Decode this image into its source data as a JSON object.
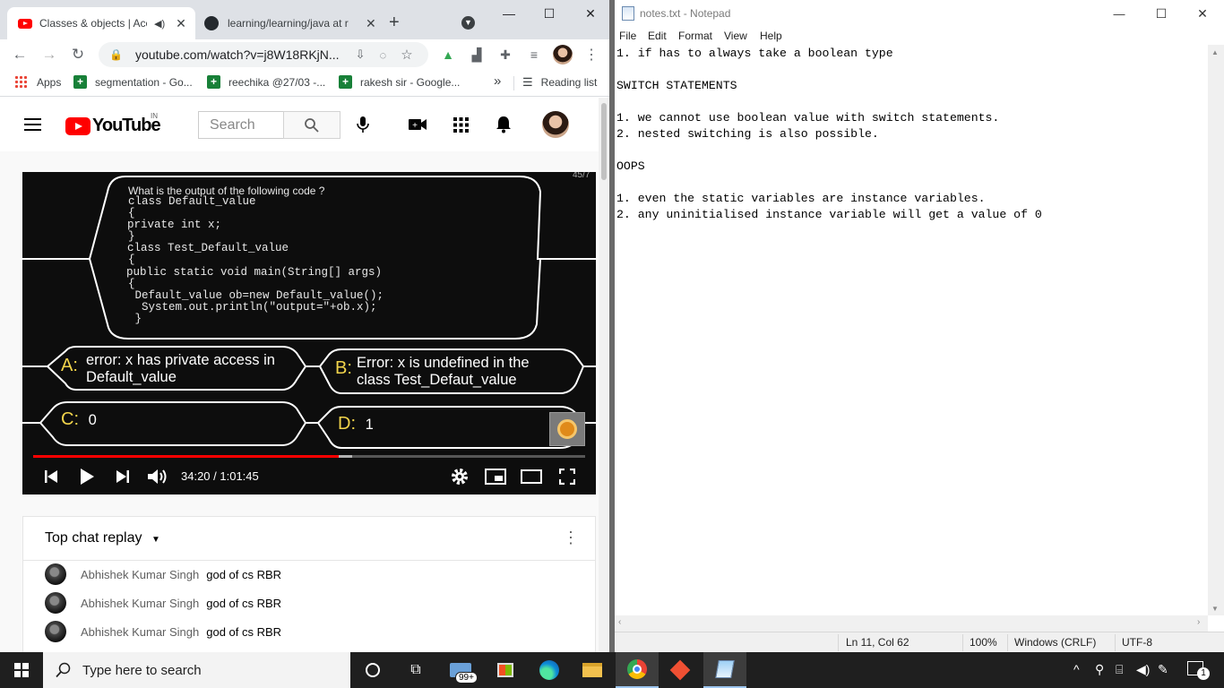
{
  "chrome": {
    "tabs": [
      {
        "title": "Classes & objects | Acc",
        "active": true
      },
      {
        "title": "learning/learning/java at r",
        "active": false
      }
    ],
    "new_tab": "+",
    "url": "youtube.com/watch?v=j8W18RKjN...",
    "bookmarks": [
      {
        "label": "Apps"
      },
      {
        "label": "segmentation - Go..."
      },
      {
        "label": "reechika @27/03 -..."
      },
      {
        "label": "rakesh sir - Google..."
      }
    ],
    "bookmarks_more": "»",
    "reading_list": "Reading list"
  },
  "youtube": {
    "logo_text": "YouTube",
    "country": "IN",
    "search_placeholder": "Search",
    "video": {
      "question": "What is the output of the following code ?",
      "code_lines": [
        "class Default_value",
        "{",
        "private int x;",
        "}",
        "class Test_Default_value",
        "{",
        "public static void main(String[] args)",
        "{",
        " Default_value ob=new Default_value();",
        "  System.out.println(\"output=\"+ob.x);",
        " }"
      ],
      "answers": {
        "a_letter": "A:",
        "a_text1": "error: x has private access in",
        "a_text2": "Default_value",
        "b_letter": "B:",
        "b_text1": "Error: x is undefined in the",
        "b_text2": "class Test_Defaut_value",
        "c_letter": "C:",
        "c_text": "0",
        "d_letter": "D:",
        "d_text": "1"
      },
      "page_counter": "45/7",
      "time": "34:20 / 1:01:45",
      "progress_fraction": 0.5535,
      "buffered_fraction": 0.5785
    },
    "chat": {
      "title": "Top chat replay",
      "messages": [
        {
          "author": "Abhishek Kumar Singh",
          "text": "god of cs RBR"
        },
        {
          "author": "Abhishek Kumar Singh",
          "text": "god of cs RBR"
        },
        {
          "author": "Abhishek Kumar Singh",
          "text": "god of cs RBR"
        }
      ]
    }
  },
  "notepad": {
    "title": "notes.txt - Notepad",
    "menu": [
      "File",
      "Edit",
      "Format",
      "View",
      "Help"
    ],
    "lines": [
      "1. if has to always take a boolean type",
      "",
      "SWITCH STATEMENTS",
      "",
      "1. we cannot use boolean value with switch statements.",
      "2. nested switching is also possible.",
      "",
      "OOPS",
      "",
      "1. even the static variables are instance variables.",
      "2. any uninitialised instance variable will get a value of 0"
    ],
    "status": {
      "position": "Ln 11, Col 62",
      "zoom": "100%",
      "line_ending": "Windows (CRLF)",
      "encoding": "UTF-8"
    }
  },
  "taskbar": {
    "search_placeholder": "Type here to search",
    "mail_badge": "99+",
    "notification_count": "1"
  }
}
